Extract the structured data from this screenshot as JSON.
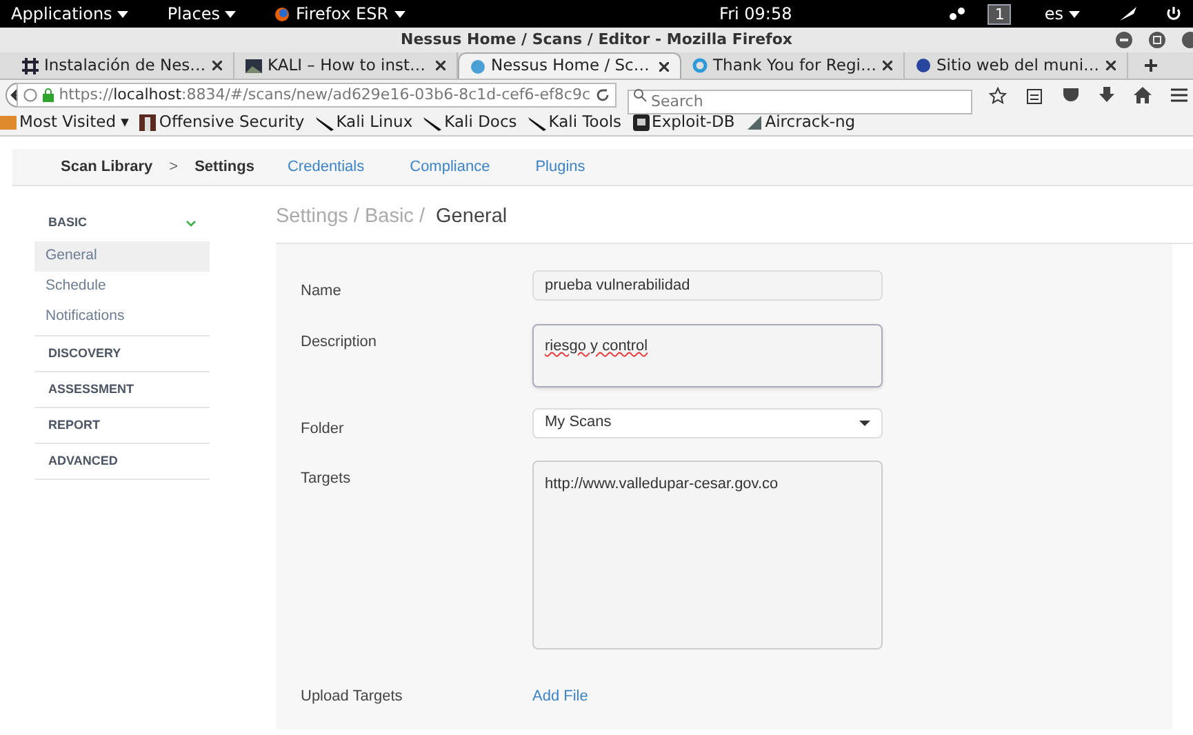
{
  "top_bar": {
    "menus": [
      "Applications",
      "Places",
      "Firefox ESR"
    ],
    "clock": "Fri 09:58",
    "workspace": "1",
    "language": "es"
  },
  "window": {
    "title": "Nessus Home / Scans / Editor - Mozilla Firefox"
  },
  "tabs": [
    {
      "label": "Instalación de Nes…",
      "selected": false
    },
    {
      "label": "KALI – How to inst…",
      "selected": false
    },
    {
      "label": "Nessus Home / Sc…",
      "selected": true
    },
    {
      "label": "Thank You for Regi…",
      "selected": false
    },
    {
      "label": "Sitio web del muni…",
      "selected": false
    }
  ],
  "address_bar": {
    "prefix": "https://",
    "host": "localhost",
    "rest": ":8834/#/scans/new/ad629e16-03b6-8c1d-cef6-ef8c9c"
  },
  "search": {
    "placeholder": "Search"
  },
  "bookmarks": [
    "Most Visited ▾",
    "Offensive Security",
    "Kali Linux",
    "Kali Docs",
    "Kali Tools",
    "Exploit-DB",
    "Aircrack-ng"
  ],
  "nav": {
    "breadcrumb": [
      "Scan Library",
      "Settings"
    ],
    "separator": ">",
    "tabs": [
      "Credentials",
      "Compliance",
      "Plugins"
    ]
  },
  "sidebar": {
    "sections": [
      {
        "label": "BASIC",
        "expanded": true,
        "items": [
          {
            "label": "General",
            "selected": true
          },
          {
            "label": "Schedule",
            "selected": false
          },
          {
            "label": "Notifications",
            "selected": false
          }
        ]
      },
      {
        "label": "DISCOVERY",
        "expanded": false
      },
      {
        "label": "ASSESSMENT",
        "expanded": false
      },
      {
        "label": "REPORT",
        "expanded": false
      },
      {
        "label": "ADVANCED",
        "expanded": false
      }
    ]
  },
  "heading": {
    "path": "Settings / Basic / ",
    "current": "General"
  },
  "form": [
    {
      "kind": "input",
      "label": "Name",
      "value": "prueba vulnerabilidad"
    },
    {
      "kind": "textarea",
      "label": "Description",
      "value": "riesgo y control"
    },
    {
      "kind": "select",
      "label": "Folder",
      "value": "My Scans"
    },
    {
      "kind": "bigtext",
      "label": "Targets",
      "value": "http://www.valledupar-cesar.gov.co"
    },
    {
      "kind": "link",
      "label": "Upload Targets",
      "value": "Add File"
    }
  ]
}
